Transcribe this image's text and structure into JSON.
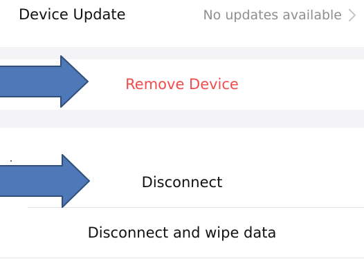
{
  "device_update": {
    "title": "Device Update",
    "status": "No updates available",
    "chevron_icon": "chevron-right-icon"
  },
  "actions": {
    "remove_device": "Remove Device",
    "disconnect": "Disconnect",
    "disconnect_wipe": "Disconnect and wipe data"
  },
  "annotations": {
    "arrow_icon": "arrow-right-icon",
    "arrow_fill": "#4f78b8",
    "arrow_stroke": "#2f4f7a"
  },
  "colors": {
    "destructive": "#f24b4b",
    "secondary_text": "#8e8e93",
    "primary_text": "#111111",
    "group_separator": "#f4f4f6"
  }
}
